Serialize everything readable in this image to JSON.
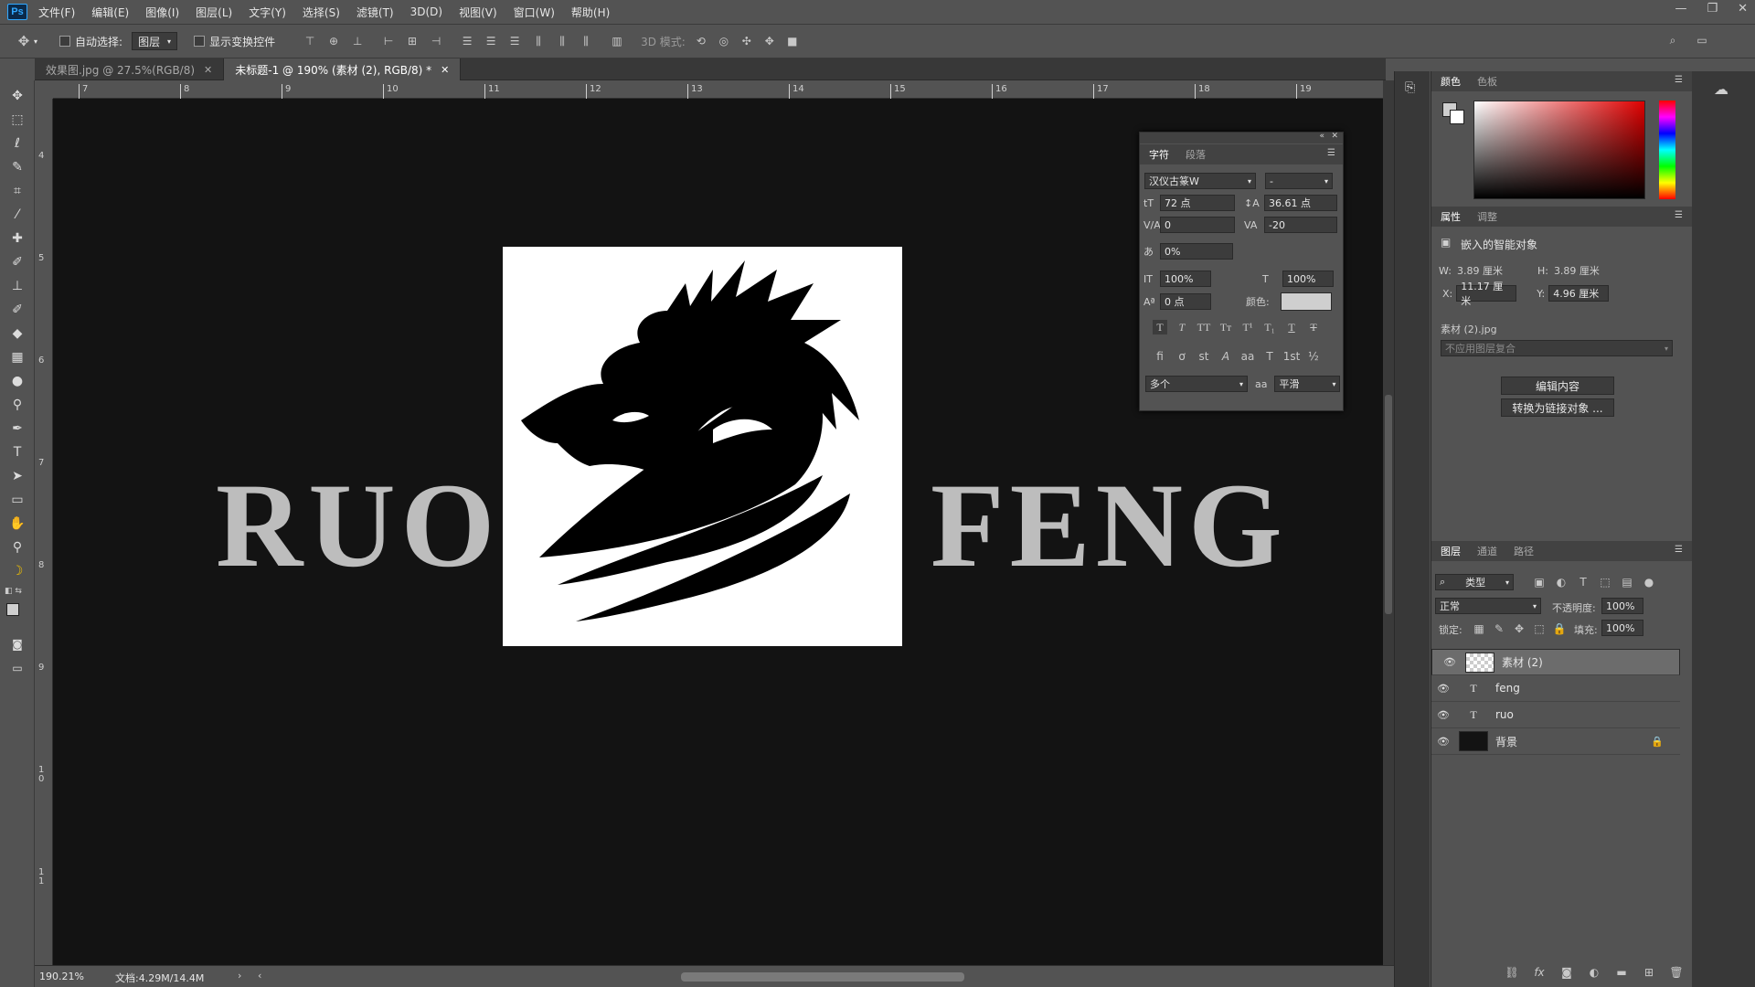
{
  "menu": [
    "文件(F)",
    "编辑(E)",
    "图像(I)",
    "图层(L)",
    "文字(Y)",
    "选择(S)",
    "滤镜(T)",
    "3D(D)",
    "视图(V)",
    "窗口(W)",
    "帮助(H)"
  ],
  "app_icon_label": "Ps",
  "options": {
    "auto_select_label": "自动选择:",
    "auto_select_value": "图层",
    "show_transform_label": "显示变换控件",
    "mode_3d_label": "3D 模式:"
  },
  "tabs": [
    {
      "label": "效果图.jpg @ 27.5%(RGB/8)"
    },
    {
      "label": "未标题-1 @ 190% (素材 (2), RGB/8) *"
    }
  ],
  "ruler_top": [
    "7",
    "8",
    "9",
    "10",
    "11",
    "12",
    "13",
    "14",
    "15",
    "16",
    "17",
    "18",
    "19"
  ],
  "ruler_left": [
    "4",
    "5",
    "6",
    "7",
    "8",
    "9",
    "10",
    "11"
  ],
  "canvas": {
    "text_left": "RUO",
    "text_right": "FENG"
  },
  "status": {
    "zoom": "190.21%",
    "doc": "文档:4.29M/14.4M"
  },
  "char_panel": {
    "tab_char": "字符",
    "tab_para": "段落",
    "font": "汉仪古篆W",
    "style": "-",
    "size": "72 点",
    "leading": "36.61 点",
    "kerning": "0",
    "tracking": "-20",
    "tsume": "0%",
    "vscale": "100%",
    "hscale": "100%",
    "baseline": "0 点",
    "color_label": "颜色:",
    "lang": "多个",
    "aa_label": "aa",
    "aa": "平滑"
  },
  "color_panel": {
    "tab_color": "颜色",
    "tab_swatch": "色板"
  },
  "props_panel": {
    "tab_props": "属性",
    "tab_adjust": "调整",
    "type": "嵌入的智能对象",
    "w_label": "W:",
    "w": "3.89 厘米",
    "h_label": "H:",
    "h": "3.89 厘米",
    "x_label": "X:",
    "x": "11.17 厘米",
    "y_label": "Y:",
    "y": "4.96 厘米",
    "file": "素材 (2).jpg",
    "comp": "不应用图层复合",
    "edit_btn": "编辑内容",
    "link_btn": "转换为链接对象 ..."
  },
  "layers_panel": {
    "tab_layers": "图层",
    "tab_channels": "通道",
    "tab_paths": "路径",
    "filter": "类型",
    "blend": "正常",
    "opacity_label": "不透明度:",
    "opacity": "100%",
    "lock_label": "锁定:",
    "fill_label": "填充:",
    "fill": "100%",
    "layers": [
      {
        "name": "素材 (2)",
        "kind": "smart"
      },
      {
        "name": "feng",
        "kind": "text"
      },
      {
        "name": "ruo",
        "kind": "text"
      },
      {
        "name": "背景",
        "kind": "bg"
      }
    ]
  }
}
